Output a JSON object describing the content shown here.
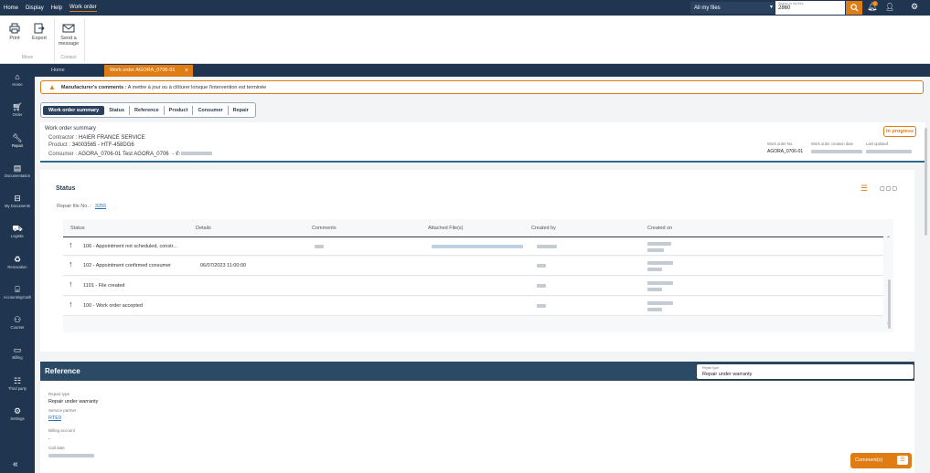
{
  "menu": {
    "items": [
      "Home",
      "Display",
      "Help",
      "Work order"
    ],
    "active": "Work order"
  },
  "topbar": {
    "files_filter": "All my files",
    "search_placeholder": "Search in my files",
    "search_value": "2860",
    "notification_count": "1"
  },
  "ribbon": {
    "print": "Print",
    "export": "Export",
    "send_message_1": "Send a",
    "send_message_2": "message",
    "group_move": "Move",
    "group_contact": "Contact"
  },
  "sidebar": {
    "items": [
      {
        "label": "Home",
        "icon": "home-icon"
      },
      {
        "label": "Order",
        "icon": "cart-icon"
      },
      {
        "label": "Repair",
        "icon": "wrench-icon"
      },
      {
        "label": "Documentation",
        "icon": "doc-icon"
      },
      {
        "label": "My Documents",
        "icon": "inbox-icon"
      },
      {
        "label": "Logistic",
        "icon": "hand-truck-icon"
      },
      {
        "label": "Renovation",
        "icon": "recycle-icon"
      },
      {
        "label": "AccountingCash",
        "icon": "register-icon"
      },
      {
        "label": "Counter",
        "icon": "people-icon"
      },
      {
        "label": "Billing",
        "icon": "card-icon"
      },
      {
        "label": "Third party",
        "icon": "contact-card-icon"
      },
      {
        "label": "Settings",
        "icon": "gear-icon"
      }
    ],
    "active": "Repair"
  },
  "tabs": {
    "home": "Home",
    "active": "Work order AGORA_0706-01"
  },
  "alert": {
    "label": "Manufacturer's comments :",
    "text": "A mettre à jour ou à clôturer lorsque l'intervention est terminée"
  },
  "pills": [
    "Work order summary",
    "Status",
    "Reference",
    "Product",
    "Consumer",
    "Repair"
  ],
  "summary": {
    "title": "Work order summary",
    "contractor_label": "Contractor :",
    "contractor": "HAIER FRANCE SERVICE",
    "product_label": "Product :",
    "product": "34003565 - HTF-458DG6",
    "consumer_label": "Consumer :",
    "consumer": "AGORA_0706-01 Test AGORA_0706",
    "status_badge": "In progress",
    "wo_no_label": "Work order No.",
    "wo_no": "AGORA_0706-01",
    "creation_label": "Work order creation date",
    "updated_label": "Last updated"
  },
  "status_section": {
    "title": "Status",
    "repair_file_label": "Repair file No. :",
    "repair_file_no": "3255",
    "columns": [
      "Status",
      "Details",
      "Comments",
      "Attached File(s)",
      "Created by",
      "Created on"
    ],
    "rows": [
      {
        "status": "106 - Appointment not scheduled, constr...",
        "details": ""
      },
      {
        "status": "102 - Appointment confirmed consumer",
        "details": "06/07/2023 11:00:00"
      },
      {
        "status": "1101 - File created",
        "details": ""
      },
      {
        "status": "100 - Work order accepted",
        "details": ""
      }
    ]
  },
  "reference": {
    "title": "Reference",
    "repair_type_label": "Repair type",
    "repair_type": "Repair under warranty",
    "service_partner_label": "Service partner",
    "service_partner": "RTE9",
    "billing_account_label": "Billing account",
    "billing_account": "-",
    "call_date_label": "Call date"
  },
  "comments_button": "Comment(s)",
  "colors": {
    "navy": "#1f3550",
    "accent": "#e07c14",
    "link": "#2a6eb4"
  }
}
